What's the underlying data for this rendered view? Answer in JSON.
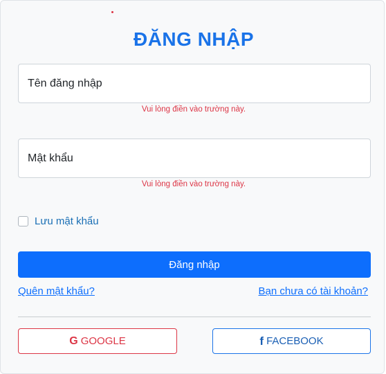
{
  "form": {
    "title": "ĐĂNG NHẬP",
    "username_placeholder": "Tên đăng nhập",
    "username_value": "",
    "username_error": "Vui lòng điền vào trường này.",
    "password_placeholder": "Mật khẩu",
    "password_value": "",
    "password_error": "Vui lòng điền vào trường này.",
    "remember_label": "Lưu mật khẩu",
    "remember_checked": false,
    "submit_label": "Đăng nhập",
    "forgot_link": "Quên mật khẩu?",
    "register_link": "Bạn chưa có tài khoản?"
  },
  "social": {
    "google_label": "GOOGLE",
    "google_icon": "google-icon",
    "google_glyph": "G",
    "facebook_label": "FACEBOOK",
    "facebook_icon": "facebook-icon",
    "facebook_glyph": "f"
  },
  "colors": {
    "accent": "#0d6efd",
    "title": "#1a73e8",
    "error": "#dc3545"
  }
}
